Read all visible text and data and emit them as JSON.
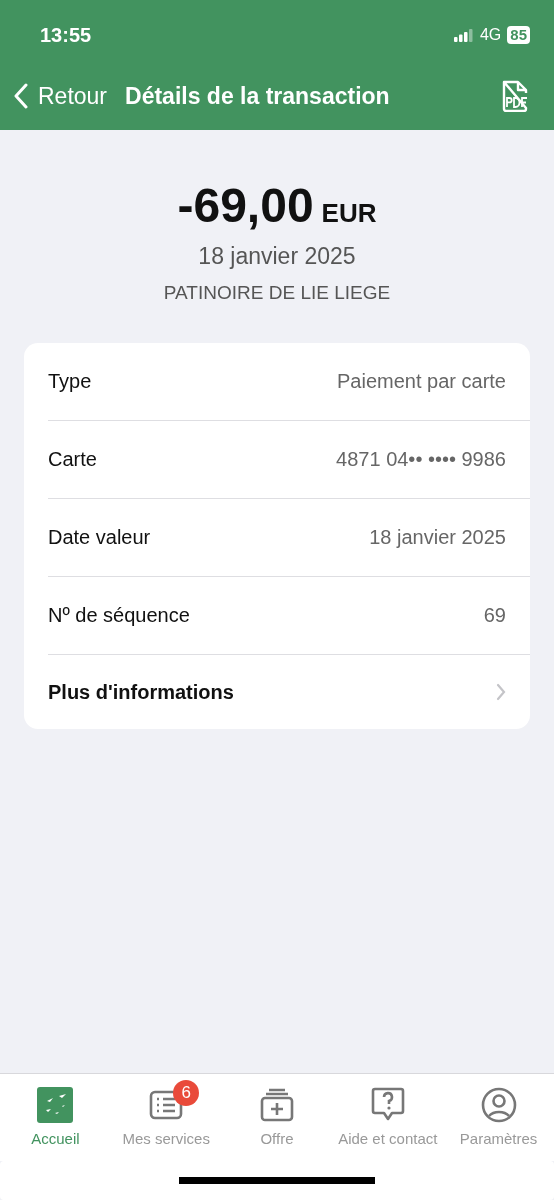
{
  "status_bar": {
    "time": "13:55",
    "network": "4G",
    "battery": "85"
  },
  "nav": {
    "back": "Retour",
    "title": "Détails de la transaction"
  },
  "summary": {
    "amount": "-69,00",
    "currency": "EUR",
    "date": "18 janvier 2025",
    "merchant": "PATINOIRE DE LIE LIEGE"
  },
  "details": [
    {
      "kind": "value",
      "label": "Type",
      "value": "Paiement par carte"
    },
    {
      "kind": "value",
      "label": "Carte",
      "value": "4871 04•• •••• 9986"
    },
    {
      "kind": "value",
      "label": "Date valeur",
      "value": "18 janvier 2025"
    },
    {
      "kind": "value",
      "label": "Nº de séquence",
      "value": "69"
    },
    {
      "kind": "link",
      "label": "Plus d'informations"
    }
  ],
  "tabs": [
    {
      "kind": "home",
      "label": "Accueil",
      "selected": true
    },
    {
      "kind": "services",
      "label": "Mes services",
      "selected": false,
      "badge": "6"
    },
    {
      "kind": "offer",
      "label": "Offre",
      "selected": false
    },
    {
      "kind": "help",
      "label": "Aide et contact",
      "selected": false
    },
    {
      "kind": "settings",
      "label": "Paramètres",
      "selected": false
    }
  ]
}
